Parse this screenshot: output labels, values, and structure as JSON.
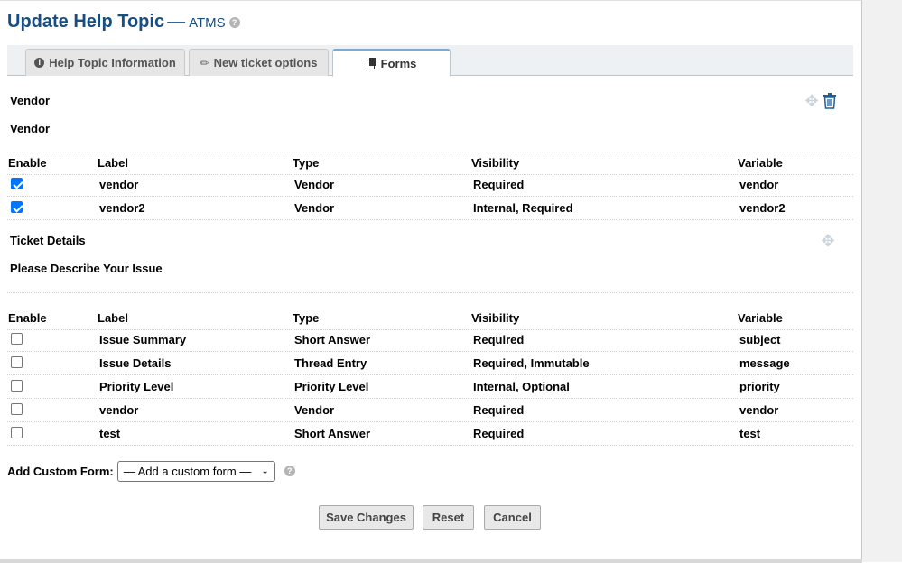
{
  "header": {
    "title": "Update Help Topic",
    "dash": "—",
    "subtitle": "ATMS",
    "help_glyph": "?"
  },
  "tabs": [
    {
      "label": "Help Topic Information",
      "icon": "info-icon",
      "active": false
    },
    {
      "label": "New ticket options",
      "icon": "tag-icon",
      "active": false
    },
    {
      "label": "Forms",
      "icon": "document-icon",
      "active": true
    }
  ],
  "forms": [
    {
      "title": "Vendor",
      "subtitle": "Vendor",
      "columns": {
        "enable": "Enable",
        "label": "Label",
        "type": "Type",
        "visibility": "Visibility",
        "variable": "Variable"
      },
      "rows": [
        {
          "checked": true,
          "label": "vendor",
          "type": "Vendor",
          "visibility": "Required",
          "variable": "vendor"
        },
        {
          "checked": true,
          "label": "vendor2",
          "type": "Vendor",
          "visibility": "Internal, Required",
          "variable": "vendor2"
        }
      ]
    },
    {
      "title": "Ticket Details",
      "subtitle": "Please Describe Your Issue",
      "columns": {
        "enable": "Enable",
        "label": "Label",
        "type": "Type",
        "visibility": "Visibility",
        "variable": "Variable"
      },
      "rows": [
        {
          "checked": false,
          "label": "Issue Summary",
          "type": "Short Answer",
          "visibility": "Required",
          "variable": "subject"
        },
        {
          "checked": false,
          "label": "Issue Details",
          "type": "Thread Entry",
          "visibility": "Required, Immutable",
          "variable": "message"
        },
        {
          "checked": false,
          "label": "Priority Level",
          "type": "Priority Level",
          "visibility": "Internal, Optional",
          "variable": "priority"
        },
        {
          "checked": false,
          "label": "vendor",
          "type": "Vendor",
          "visibility": "Required",
          "variable": "vendor"
        },
        {
          "checked": false,
          "label": "test",
          "type": "Short Answer",
          "visibility": "Required",
          "variable": "test"
        }
      ]
    }
  ],
  "add_custom_form": {
    "label": "Add Custom Form:",
    "selected": "— Add a custom form —",
    "help_glyph": "?"
  },
  "buttons": {
    "save": "Save Changes",
    "reset": "Reset",
    "cancel": "Cancel"
  },
  "colors": {
    "title": "#184e81",
    "checkbox_checked": "#0075ff",
    "active_tab_accent": "#7eaad1"
  }
}
